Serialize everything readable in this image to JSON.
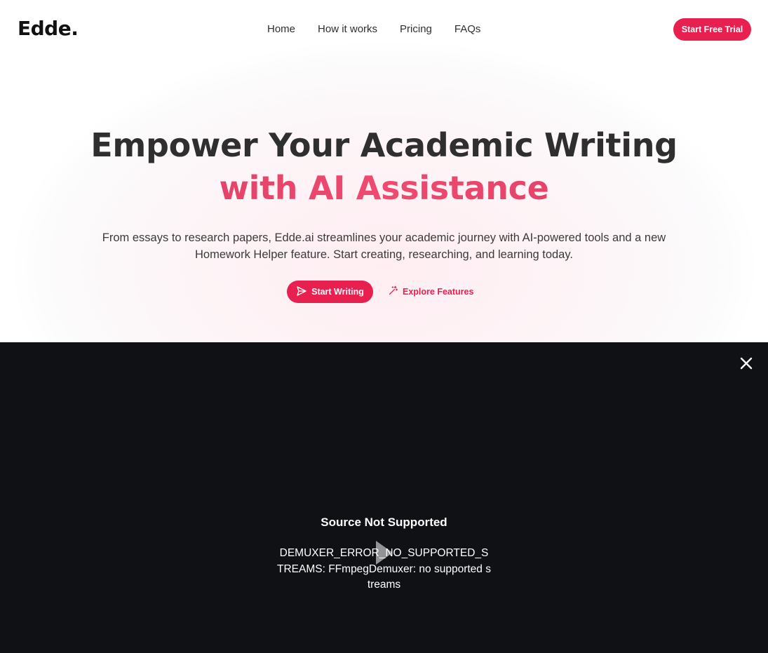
{
  "header": {
    "logo": "Edde.",
    "nav": [
      "Home",
      "How it works",
      "Pricing",
      "FAQs"
    ],
    "cta": "Start Free Trial"
  },
  "hero": {
    "title_line1": "Empower Your Academic Writing",
    "title_line2": "with AI Assistance",
    "subtitle_line1": "From essays to research papers, Edde.ai streamlines your academic journey with AI-powered tools and a new",
    "subtitle_line2": "Homework Helper feature. Start creating, researching, and learning today.",
    "primary_cta": "Start Writing",
    "secondary_cta": "Explore Features"
  },
  "video_player": {
    "error_title": "Source Not Supported",
    "error_message": "DEMUXER_ERROR_NO_SUPPORTED_STREAMS: FFmpegDemuxer: no supported streams"
  },
  "colors": {
    "accent": "#e8204f",
    "player_bg": "#0f1115"
  },
  "icons": [
    "send-icon",
    "magic-wand-icon",
    "close-icon",
    "play-icon"
  ]
}
